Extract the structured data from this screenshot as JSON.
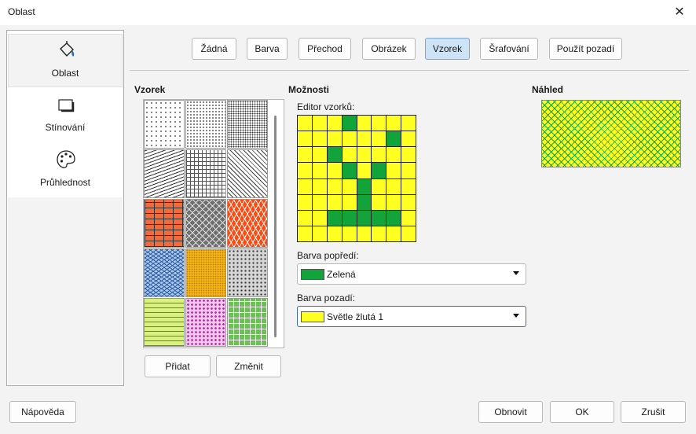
{
  "window": {
    "title": "Oblast",
    "close_glyph": "✕"
  },
  "sidebar": {
    "items": [
      {
        "label": "Oblast",
        "icon": "fill-bucket-icon"
      },
      {
        "label": "Stínování",
        "icon": "shadow-icon"
      },
      {
        "label": "Průhlednost",
        "icon": "palette-icon"
      }
    ],
    "active_index": 0
  },
  "fill_tabs": {
    "items": [
      "Žádná",
      "Barva",
      "Přechod",
      "Obrázek",
      "Vzorek",
      "Šrafování",
      "Použít pozadí"
    ],
    "active": "Vzorek"
  },
  "pattern_section": {
    "heading": "Vzorek",
    "add_label": "Přidat",
    "change_label": "Změnit",
    "swatch_colors": [
      "#ffffff",
      "#ffffff",
      "#ffffff",
      "#ffffff",
      "#ffffff",
      "#ffffff",
      "#f06a3c",
      "#6e6e6e",
      "#ff4a12",
      "#a9c8ea",
      "#f2b417",
      "#d5d5d5",
      "#d9f082",
      "#f3c6ee",
      "#6cbf57"
    ]
  },
  "options_section": {
    "heading": "Možnosti",
    "editor_label": "Editor vzorků:",
    "editor_grid": [
      [
        0,
        0,
        0,
        1,
        0,
        0,
        0,
        0
      ],
      [
        0,
        0,
        0,
        0,
        0,
        0,
        1,
        0
      ],
      [
        0,
        0,
        1,
        0,
        0,
        0,
        0,
        0
      ],
      [
        0,
        0,
        0,
        1,
        0,
        1,
        0,
        0
      ],
      [
        0,
        0,
        0,
        0,
        1,
        0,
        0,
        0
      ],
      [
        0,
        0,
        0,
        0,
        1,
        0,
        0,
        0
      ],
      [
        0,
        0,
        1,
        1,
        1,
        1,
        1,
        0
      ],
      [
        0,
        0,
        0,
        0,
        0,
        0,
        0,
        0
      ]
    ],
    "foreground_label": "Barva popředí:",
    "foreground_value": "Zelená",
    "foreground_color": "#12a33a",
    "background_label": "Barva pozadí:",
    "background_value": "Světle žlutá 1",
    "background_color": "#ffff22"
  },
  "preview_section": {
    "heading": "Náhled"
  },
  "footer": {
    "help_label": "Nápověda",
    "reset_label": "Obnovit",
    "ok_label": "OK",
    "cancel_label": "Zrušit"
  }
}
